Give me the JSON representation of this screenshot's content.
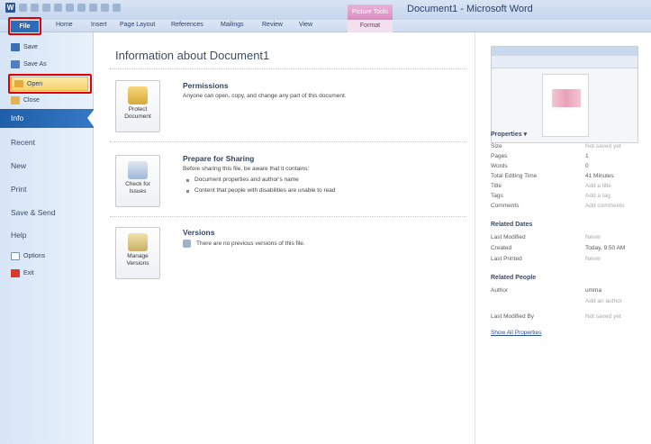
{
  "window": {
    "title": "Document1 - Microsoft Word",
    "context_tab_group": "Picture Tools"
  },
  "ribbon": {
    "file_tab": "File",
    "tabs": [
      "Home",
      "Insert",
      "Page Layout",
      "References",
      "Mailings",
      "Review",
      "View"
    ],
    "context_tab": "Format"
  },
  "sidebar": {
    "save": "Save",
    "save_as": "Save As",
    "open": "Open",
    "close": "Close",
    "info": "Info",
    "recent": "Recent",
    "new": "New",
    "print": "Print",
    "save_send": "Save & Send",
    "help": "Help",
    "options": "Options",
    "exit": "Exit"
  },
  "main": {
    "title": "Information about Document1",
    "permissions": {
      "button": "Protect Document",
      "heading": "Permissions",
      "text": "Anyone can open, copy, and change any part of this document."
    },
    "sharing": {
      "button": "Check for Issues",
      "heading": "Prepare for Sharing",
      "text": "Before sharing this file, be aware that it contains:",
      "bullets": [
        "Document properties and author's name",
        "Content that people with disabilities are unable to read"
      ]
    },
    "versions": {
      "button": "Manage Versions",
      "heading": "Versions",
      "text": "There are no previous versions of this file."
    }
  },
  "properties": {
    "heading": "Properties",
    "rows": [
      {
        "label": "Size",
        "value": "Not saved yet"
      },
      {
        "label": "Pages",
        "value": "1"
      },
      {
        "label": "Words",
        "value": "0"
      },
      {
        "label": "Total Editing Time",
        "value": "41 Minutes"
      },
      {
        "label": "Title",
        "value": "Add a title"
      },
      {
        "label": "Tags",
        "value": "Add a tag"
      },
      {
        "label": "Comments",
        "value": "Add comments"
      }
    ],
    "dates_heading": "Related Dates",
    "dates": [
      {
        "label": "Last Modified",
        "value": "Never"
      },
      {
        "label": "Created",
        "value": "Today, 9:50 AM"
      },
      {
        "label": "Last Printed",
        "value": "Never"
      }
    ],
    "people_heading": "Related People",
    "author_label": "Author",
    "author_value": "umma",
    "add_author": "Add an author",
    "last_modified_by_label": "Last Modified By",
    "last_modified_by_value": "Not saved yet",
    "show_all": "Show All Properties"
  },
  "colors": {
    "accent": "#2c6bb8",
    "highlight": "#e00000",
    "open_hover": "#f5d36c"
  }
}
